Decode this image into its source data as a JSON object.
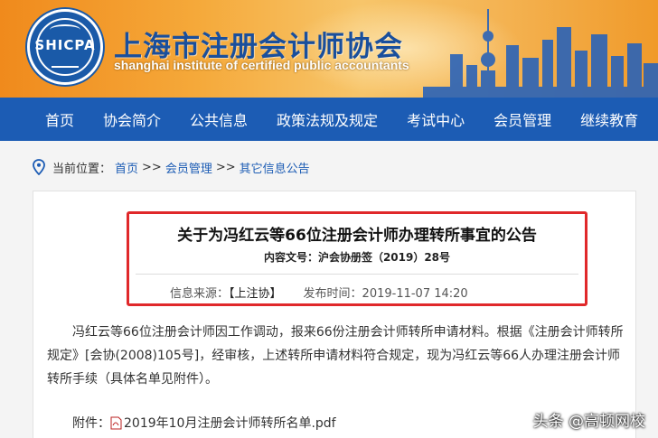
{
  "header": {
    "title_cn": "上海市注册会计师协会",
    "title_en": "shanghai institute of certified public accountants",
    "logo_text": "SHICPA",
    "logo_color": "#1a5aa8"
  },
  "nav": {
    "items": [
      "首页",
      "协会简介",
      "公共信息",
      "政策法规及规定",
      "考试中心",
      "会员管理",
      "继续教育"
    ],
    "background": "#1c5cb4"
  },
  "breadcrumb": {
    "prefix": "当前位置：",
    "home": "首页",
    "sep1": ">>",
    "level2": "会员管理",
    "sep2": ">>",
    "level3": "其它信息公告",
    "icon": "location-pin-icon"
  },
  "article": {
    "title": "关于为冯红云等66位注册会计师办理转所事宜的公告",
    "doc_number": "内容文号：沪会协册签（2019）28号",
    "source_label": "信息来源：",
    "source_value": "【上注协】",
    "date_label": "发布时间：",
    "date_value": "2019-11-07 14:20",
    "body": "冯红云等66位注册会计师因工作调动，报来66份注册会计师转所申请材料。根据《注册会计师转所规定》[会协(2008)105号]，经审核，上述转所申请材料符合规定，现为冯红云等66人办理注册会计师转所手续（具体名单见附件）。",
    "attachment_label": "附件：",
    "attachment_file": "2019年10月注册会计师转所名单.pdf",
    "highlight_color": "#e0282a"
  },
  "watermark": "头条 @高顿网校"
}
